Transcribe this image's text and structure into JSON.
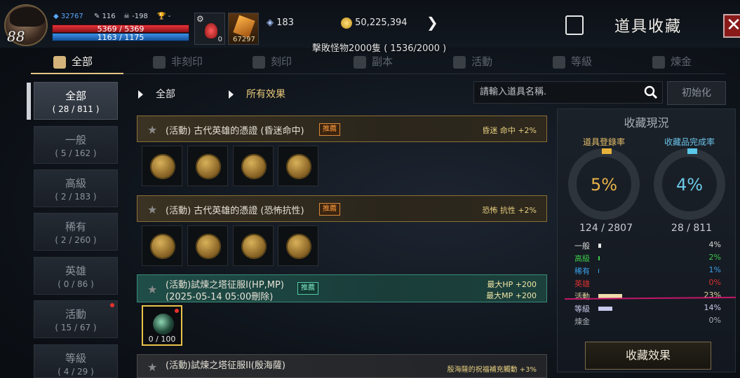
{
  "player": {
    "level": "88",
    "stat1": "32767",
    "stat2": "116",
    "stat3": "-198",
    "stat4": "-",
    "hp": "5369 / 5369",
    "mp": "1163 / 1175",
    "potion_count": "0",
    "item_count": "67297"
  },
  "currency": {
    "crystal": "183",
    "gold": "50,225,394"
  },
  "quest": "擊敗怪物2000隻 ( 1536/2000 )",
  "window_title": "道具收藏",
  "tabs": [
    {
      "label": "全部",
      "icon": "book-icon"
    },
    {
      "label": "非刻印",
      "icon": "shield-icon"
    },
    {
      "label": "刻印",
      "icon": "shield-icon"
    },
    {
      "label": "副本",
      "icon": "dungeon-icon"
    },
    {
      "label": "活動",
      "icon": "gift-icon"
    },
    {
      "label": "等級",
      "icon": "level-icon"
    },
    {
      "label": "煉金",
      "icon": "alchemy-icon"
    }
  ],
  "categories": [
    {
      "name": "全部",
      "count": "( 28 / 811 )"
    },
    {
      "name": "一般",
      "count": "( 5 / 162 )"
    },
    {
      "name": "高級",
      "count": "( 2 / 183 )"
    },
    {
      "name": "稀有",
      "count": "( 2 / 260 )"
    },
    {
      "name": "英雄",
      "count": "( 0 / 86 )"
    },
    {
      "name": "活動",
      "count": "( 15 / 67 )"
    },
    {
      "name": "等級",
      "count": "( 4 / 29 )"
    }
  ],
  "filters": {
    "left": "全部",
    "right": "所有效果"
  },
  "search": {
    "placeholder": "請輸入道具名稱."
  },
  "reset_label": "初始化",
  "items": [
    {
      "name": "(活動) 古代英雄的憑證 (昏迷命中)",
      "badge": "推薦",
      "effect": "昏迷 命中 +2%"
    },
    {
      "name": "(活動) 古代英雄的憑證 (恐怖抗性)",
      "badge": "推薦",
      "effect": "恐怖 抗性 +2%"
    },
    {
      "name": "(活動)試煉之塔征服I(HP,MP)",
      "name2": "(2025-05-14 05:00刪除)",
      "badge": "推薦",
      "effect": "最大HP +200",
      "effect2": "最大MP +200"
    },
    {
      "name": "(活動)試煉之塔征服II(殷海薩)",
      "effect": "殷海薩的祝福補充觸動 +3%"
    }
  ],
  "gem_count": "0 / 100",
  "panel": {
    "title": "收藏現況",
    "reg_label": "道具登錄率",
    "comp_label": "收藏品完成率",
    "reg_pct": "5%",
    "comp_pct": "4%",
    "reg_frac": "124 / 2807",
    "comp_frac": "28 / 811",
    "rows": [
      {
        "name": "一般",
        "pct": "4%"
      },
      {
        "name": "高級",
        "pct": "2%"
      },
      {
        "name": "稀有",
        "pct": "1%"
      },
      {
        "name": "英雄",
        "pct": "0%"
      },
      {
        "name": "活動",
        "pct": "23%"
      },
      {
        "name": "等級",
        "pct": "14%"
      },
      {
        "name": "煉金",
        "pct": "0%"
      }
    ],
    "effect_button": "收藏效果"
  },
  "colors": {
    "accent": "#e6c486",
    "green_rank": "#3cc84a",
    "blue_rank": "#3aa0e6",
    "red_rank": "#d83030"
  }
}
